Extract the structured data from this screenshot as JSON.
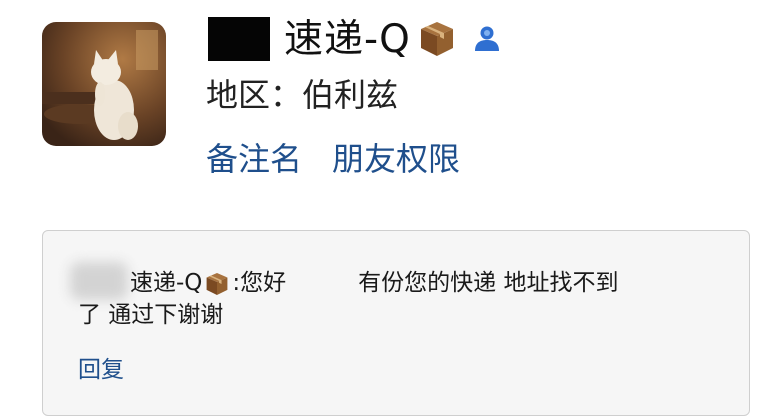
{
  "profile": {
    "name": "速递-Q",
    "region_label": "地区：",
    "region_value": "伯利兹",
    "icons": [
      "redacted-box",
      "package-emoji",
      "verified-user-icon"
    ]
  },
  "actions": {
    "remark": "备注名",
    "permissions": "朋友权限"
  },
  "message": {
    "sender": "速递-Q",
    "colon": ":",
    "greeting": "您好",
    "text_part1": "有份您的快递 地址找不到",
    "text_part2": "了 通过下谢谢",
    "reply": "回复"
  },
  "colors": {
    "link": "#1f4f8c",
    "verify": "#2f6fd1",
    "package": "#8a5a2b"
  }
}
